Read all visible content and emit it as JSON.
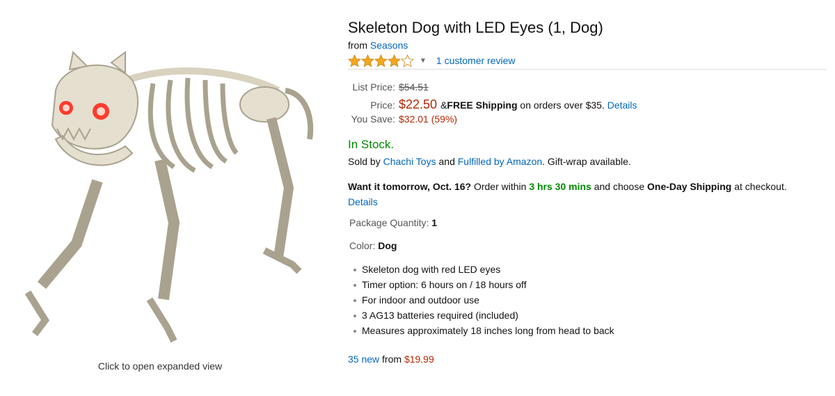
{
  "product": {
    "title": "Skeleton Dog with LED Eyes (1, Dog)",
    "from_label": "from",
    "brand": "Seasons",
    "rating": 4,
    "rating_max": 5,
    "review_link": "1 customer review",
    "image_caption": "Click to open expanded view"
  },
  "pricing": {
    "list_label": "List Price:",
    "list_price": "$54.51",
    "price_label": "Price:",
    "price": "$22.50",
    "shipping_prefix": "& ",
    "shipping_bold": "FREE Shipping",
    "shipping_suffix": " on orders over $35.",
    "details_link": "Details",
    "save_label": "You Save:",
    "save_value": "$32.01 (59%)"
  },
  "availability": {
    "stock": "In Stock.",
    "sold_by_prefix": "Sold by ",
    "seller": "Chachi Toys",
    "and": " and ",
    "fulfilled": "Fulfilled by Amazon",
    "gift": ". Gift-wrap available."
  },
  "delivery": {
    "bold_lead": "Want it tomorrow, Oct. 16?",
    "order_within": " Order within ",
    "countdown": "3 hrs 30 mins",
    "choose": " and choose ",
    "shipping_option": "One-Day Shipping",
    "suffix": " at checkout.",
    "details_link": "Details"
  },
  "variations": {
    "qty_label": "Package Quantity:",
    "qty_value": "1",
    "color_label": "Color:",
    "color_value": "Dog"
  },
  "features": [
    "Skeleton dog with red LED eyes",
    "Timer option: 6 hours on / 18 hours off",
    "For indoor and outdoor use",
    "3 AG13 batteries required (included)",
    "Measures approximately 18 inches long from head to back"
  ],
  "offers": {
    "count_link": "35 new",
    "from": " from ",
    "price": "$19.99"
  },
  "colors": {
    "link": "#0066c0",
    "price": "#b12704",
    "in_stock": "#008a00",
    "star": "#f4a81d"
  }
}
